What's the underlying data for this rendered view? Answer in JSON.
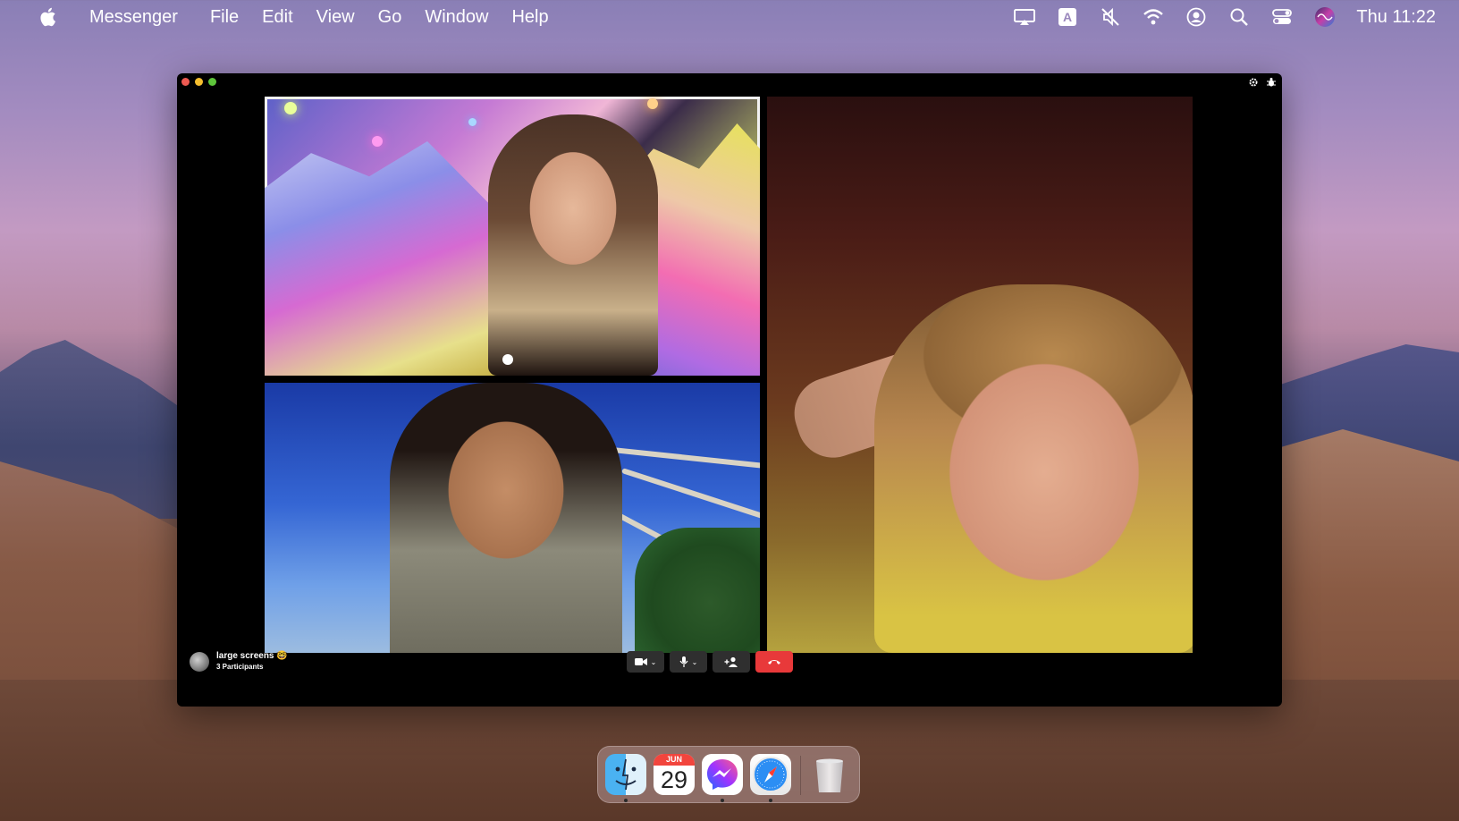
{
  "menubar": {
    "app_name": "Messenger",
    "menus": [
      "File",
      "Edit",
      "View",
      "Go",
      "Window",
      "Help"
    ],
    "clock": "Thu 11:22",
    "status_icons": [
      "airplay-icon",
      "input-source-icon",
      "mute-icon",
      "wifi-icon",
      "user-icon",
      "spotlight-icon",
      "control-center-icon",
      "siri-icon"
    ]
  },
  "call": {
    "title": "large screens 🤓",
    "participants": "3 Participants",
    "participant_tiles": [
      {
        "name": "participant-1",
        "selected": true
      },
      {
        "name": "participant-2",
        "selected": false
      },
      {
        "name": "participant-3",
        "selected": false
      }
    ]
  },
  "controls": {
    "video": "video-camera-icon",
    "mic": "microphone-icon",
    "add": "add-person-icon",
    "end": "end-call-icon"
  },
  "dock": {
    "calendar_month": "JUN",
    "calendar_day": "29",
    "apps": [
      "Finder",
      "Calendar",
      "Messenger",
      "Safari",
      "Trash"
    ]
  },
  "colors": {
    "end_call": "#e8393a",
    "control_bg": "#2f2f2f",
    "selected_border": "#f1f1f1"
  }
}
